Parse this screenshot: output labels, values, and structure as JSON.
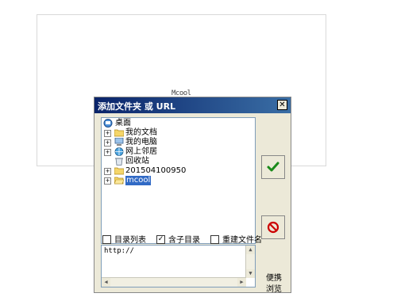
{
  "background": {
    "caption": "Mcool"
  },
  "dialog": {
    "title": "添加文件夹 或 URL",
    "close_symbol": "✕",
    "tree": [
      {
        "label": "桌面",
        "icon": "desktop-icon"
      },
      {
        "label": "我的文档",
        "icon": "folder-icon"
      },
      {
        "label": "我的电脑",
        "icon": "computer-icon"
      },
      {
        "label": "网上邻居",
        "icon": "network-icon"
      },
      {
        "label": "回收站",
        "icon": "recycle-bin-icon"
      },
      {
        "label": "201504100950",
        "icon": "folder-icon"
      },
      {
        "label": "mcool",
        "icon": "folder-open-icon",
        "selected": true
      }
    ],
    "options": [
      {
        "label": "目录列表",
        "checked": false
      },
      {
        "label": "含子目录",
        "checked": true
      },
      {
        "label": "重建文件名",
        "checked": false
      }
    ],
    "url_text": "http://",
    "side_labels": [
      "便携",
      "浏览"
    ],
    "colors": {
      "title_bar": "#0a246a",
      "ok_check": "#1a8a1a",
      "cancel": "#cc0000",
      "selection": "#316ac5"
    }
  }
}
